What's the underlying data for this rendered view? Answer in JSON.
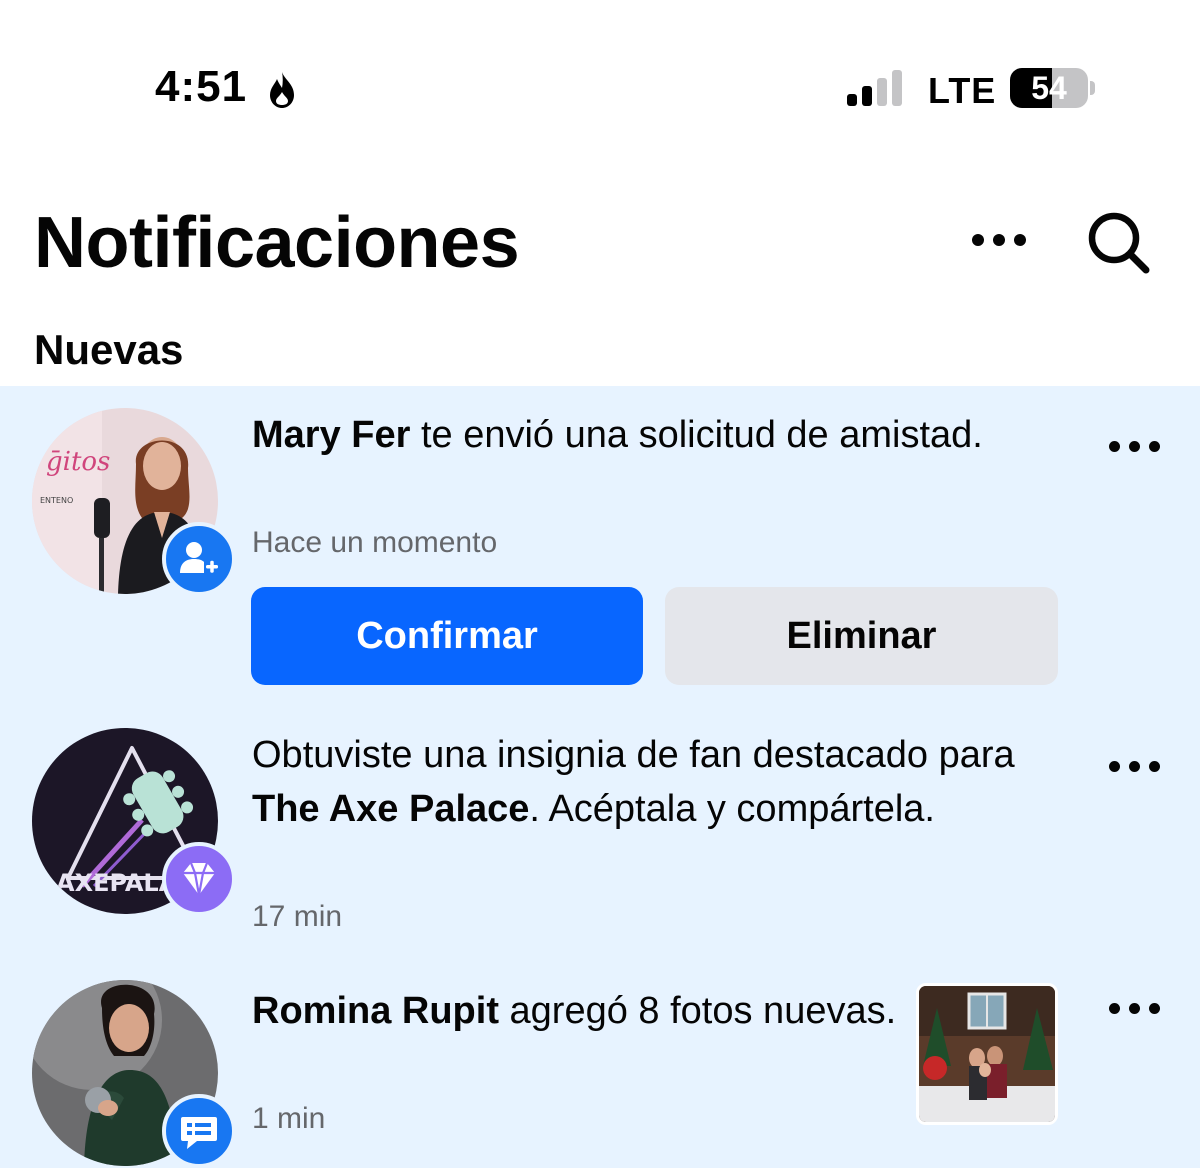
{
  "status_bar": {
    "time": "4:51",
    "network": "LTE",
    "battery": "54",
    "battery_level": 0.54
  },
  "header": {
    "title": "Notificaciones",
    "more_icon": "more-horizontal-icon",
    "search_icon": "search-icon"
  },
  "section": {
    "title": "Nuevas"
  },
  "notifications": [
    {
      "actor": "Mary Fer",
      "text": " te envió una solicitud de amistad.",
      "time": "Hace un momento",
      "badge_icon": "add-friend-icon",
      "confirm_label": "Confirmar",
      "delete_label": "Eliminar"
    },
    {
      "prefix": "Obtuviste una insignia de fan destacado para ",
      "page": "The Axe Palace",
      "suffix": ". Acéptala y compártela.",
      "time": "17 min",
      "avatar_text": "AXEPALA",
      "badge_icon": "diamond-icon"
    },
    {
      "actor": "Romina Rupit",
      "text": " agregó 8 fotos nuevas.",
      "time": "1 min",
      "badge_icon": "message-icon"
    }
  ],
  "colors": {
    "accent": "#0866ff",
    "unread_bg": "#e7f3ff",
    "secondary_text": "#65676b",
    "badge_purple": "#8c6cf5"
  }
}
